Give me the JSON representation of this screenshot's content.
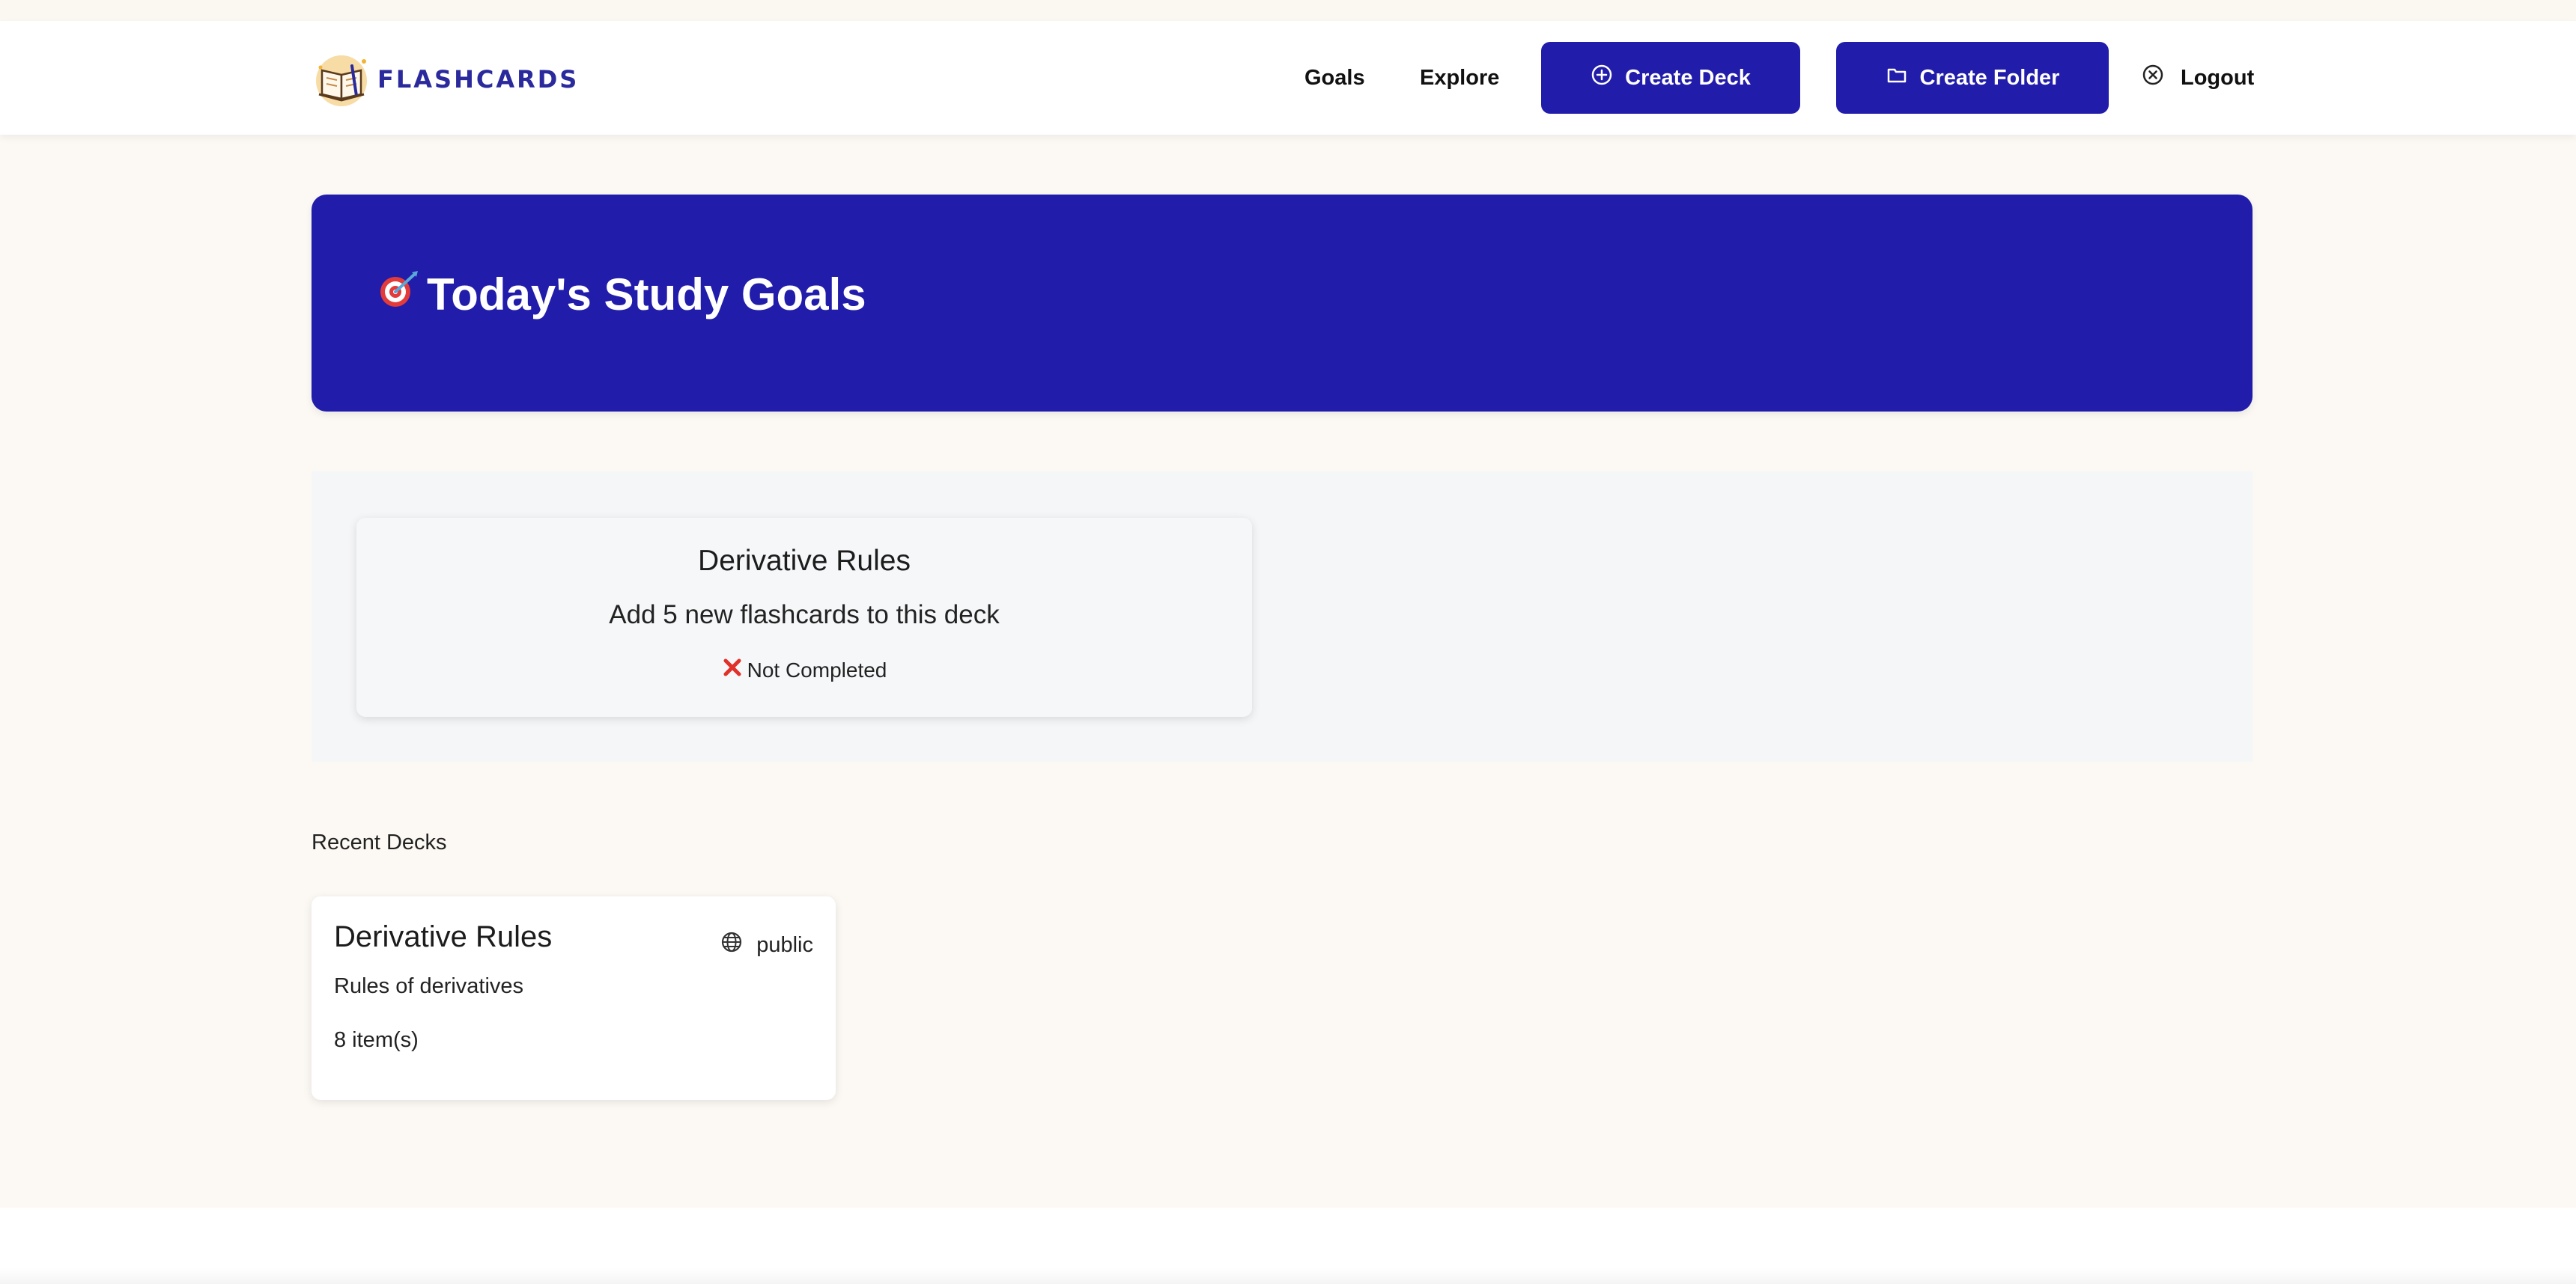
{
  "brand": {
    "name": "FLASHCARDS",
    "logo_icon": "open-book-icon"
  },
  "nav": {
    "goals_label": "Goals",
    "explore_label": "Explore",
    "create_deck_label": "Create Deck",
    "create_folder_label": "Create Folder",
    "logout_label": "Logout"
  },
  "hero": {
    "icon": "dart-target-icon",
    "title": "Today's Study Goals"
  },
  "goals": [
    {
      "deck": "Derivative Rules",
      "description": "Add 5 new flashcards to this deck",
      "status_icon": "cross-mark-icon",
      "status": "Not Completed"
    }
  ],
  "recent": {
    "label": "Recent Decks",
    "decks": [
      {
        "title": "Derivative Rules",
        "visibility": "public",
        "description": "Rules of derivatives",
        "count": "8 item(s)"
      }
    ]
  },
  "colors": {
    "primary": "#211ca9",
    "brand_text": "#2b2a9d",
    "page_bg": "#fcf9f4",
    "status_cross": "#e0312a"
  }
}
